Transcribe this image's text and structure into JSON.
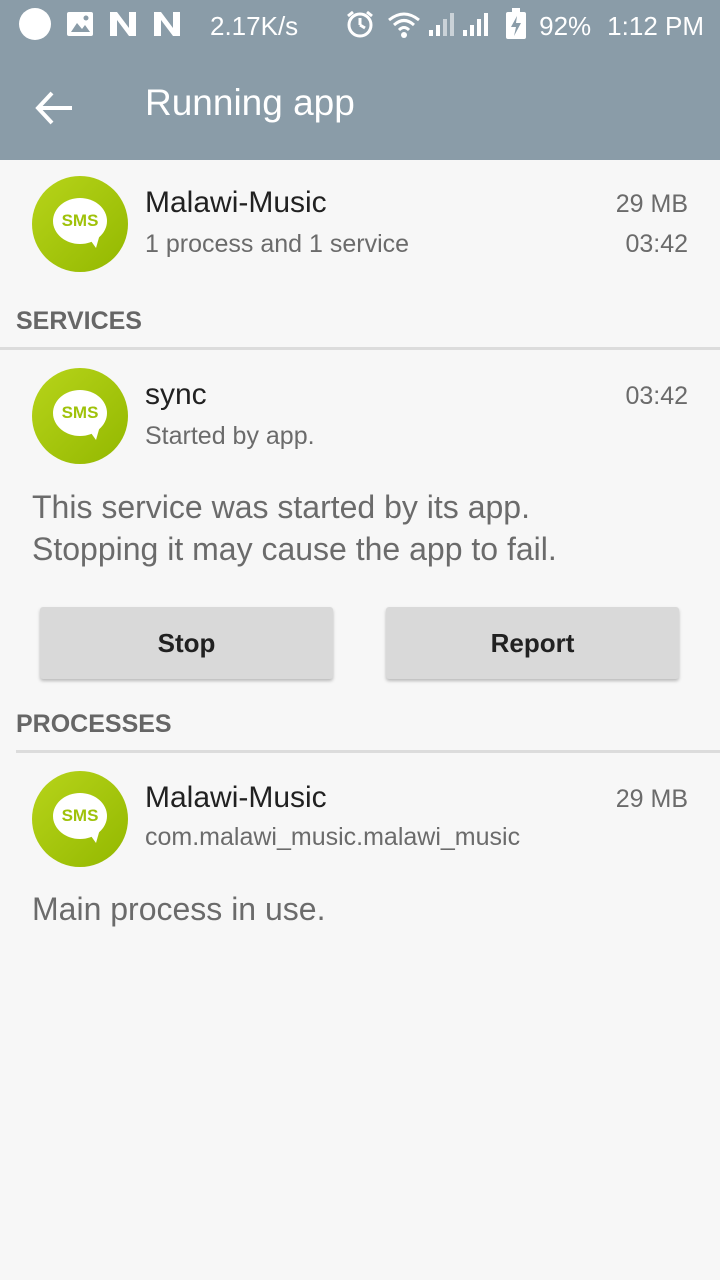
{
  "status_bar": {
    "net_speed": "2.17K/s",
    "battery": "92%",
    "time": "1:12 PM",
    "icons": [
      "circle-icon",
      "image-icon",
      "n-icon",
      "n-icon",
      "alarm-icon",
      "wifi-icon",
      "signal-icon",
      "signal-icon",
      "battery-icon"
    ]
  },
  "app_bar": {
    "title": "Running app",
    "back_icon": "back-arrow-icon"
  },
  "app": {
    "name": "Malawi-Music",
    "summary": "1 process and 1 service",
    "memory": "29 MB",
    "time": "03:42",
    "icon_text": "SMS"
  },
  "services": {
    "header": "SERVICES",
    "item": {
      "name": "sync",
      "sub": "Started by app.",
      "time": "03:42",
      "icon_text": "SMS",
      "description_line1": "This service was started by its app.",
      "description_line2": "Stopping it may cause the app to fail.",
      "stop_label": "Stop",
      "report_label": "Report"
    }
  },
  "processes": {
    "header": "PROCESSES",
    "item": {
      "name": "Malawi-Music",
      "package": "com.malawi_music.malawi_music",
      "memory": "29 MB",
      "icon_text": "SMS",
      "description": "Main process in use."
    }
  },
  "colors": {
    "appbar": "#8a9ca8",
    "icon_green": "#9fc20a",
    "background": "#f7f7f7"
  }
}
